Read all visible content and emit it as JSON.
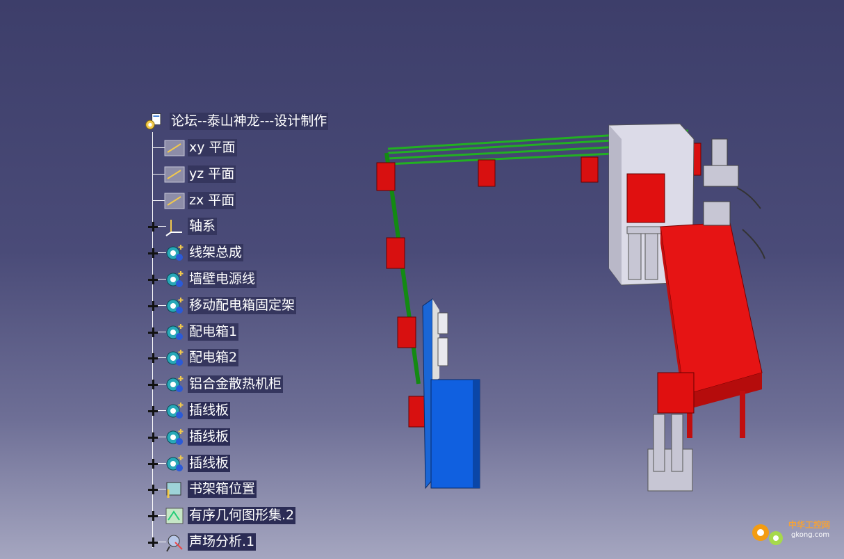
{
  "tree": {
    "root": {
      "label": "论坛--泰山神龙---设计制作",
      "icon": "product-root-icon"
    },
    "items": [
      {
        "label": "xy 平面",
        "icon": "plane-icon",
        "expandable": false
      },
      {
        "label": "yz 平面",
        "icon": "plane-icon",
        "expandable": false
      },
      {
        "label": "zx 平面",
        "icon": "plane-icon",
        "expandable": false
      },
      {
        "label": "轴系",
        "icon": "axis-system-icon",
        "expandable": true
      },
      {
        "label": "线架总成",
        "icon": "assembly-gear-icon",
        "expandable": true
      },
      {
        "label": "墙壁电源线",
        "icon": "part-gear-icon",
        "expandable": true
      },
      {
        "label": "移动配电箱固定架",
        "icon": "part-gear-icon",
        "expandable": true
      },
      {
        "label": "配电箱1",
        "icon": "part-gear-icon",
        "expandable": true
      },
      {
        "label": "配电箱2",
        "icon": "part-gear-icon",
        "expandable": true
      },
      {
        "label": "铝合金散热机柜",
        "icon": "part-gear-icon",
        "expandable": true
      },
      {
        "label": "插线板",
        "icon": "part-gear-icon",
        "expandable": true
      },
      {
        "label": "插线板",
        "icon": "part-gear-icon",
        "expandable": true
      },
      {
        "label": "插线板",
        "icon": "part-gear-icon",
        "expandable": true
      },
      {
        "label": "书架箱位置",
        "icon": "position-icon",
        "expandable": true
      },
      {
        "label": "有序几何图形集.2",
        "icon": "geometric-set-icon",
        "expandable": true
      },
      {
        "label": "声场分析.1",
        "icon": "analysis-icon",
        "expandable": true
      }
    ]
  },
  "watermark": {
    "text": "中华工控网",
    "sub": "gkong.com"
  },
  "colors": {
    "red": "#e01010",
    "green": "#20b020",
    "blue": "#1060e0",
    "gray": "#d8d8e4"
  }
}
